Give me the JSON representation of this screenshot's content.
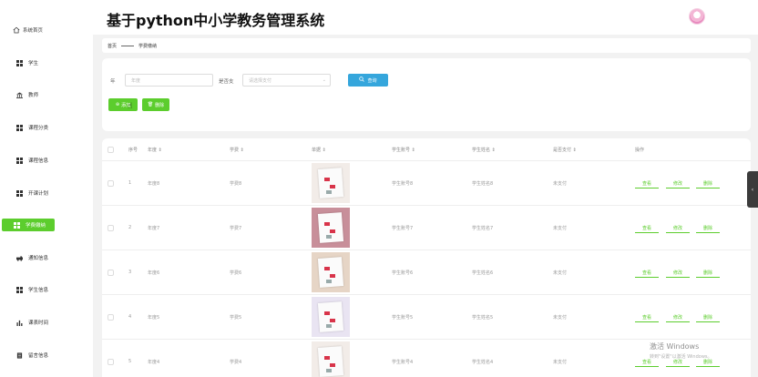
{
  "app": {
    "title": "基于python中小学教务管理系统"
  },
  "sidebar": {
    "home": "系统首页",
    "items": [
      {
        "label": "学生",
        "icon": "grid-icon"
      },
      {
        "label": "教师",
        "icon": "bank-icon"
      },
      {
        "label": "课程分类",
        "icon": "grid-icon"
      },
      {
        "label": "课程信息",
        "icon": "grid-icon"
      },
      {
        "label": "开课计划",
        "icon": "grid-icon"
      },
      {
        "label": "学费缴纳",
        "icon": "grid-icon",
        "active": true
      },
      {
        "label": "通知信息",
        "icon": "car-icon"
      },
      {
        "label": "学生信息",
        "icon": "grid-icon"
      },
      {
        "label": "课表时间",
        "icon": "bar-chart-icon"
      },
      {
        "label": "留言信息",
        "icon": "doc-icon"
      }
    ]
  },
  "breadcrumb": {
    "home": "首页",
    "current": "学费缴纳"
  },
  "search": {
    "year_label": "年",
    "year_placeholder": "年度",
    "paid_label": "是否支",
    "paid_placeholder": "请选择支付",
    "search_button": "查询",
    "add_button": "添加",
    "delete_button": "删除"
  },
  "table": {
    "headers": [
      "序号",
      "年度 ⇕",
      "学费 ⇕",
      "单据 ⇕",
      "学生账号 ⇕",
      "学生姓名 ⇕",
      "是否支付 ⇕",
      "操作"
    ],
    "rows": [
      {
        "index": "1",
        "year": "年度8",
        "fee": "学费8",
        "account": "学生账号8",
        "name": "学生姓名8",
        "paid": "未支付"
      },
      {
        "index": "2",
        "year": "年度7",
        "fee": "学费7",
        "account": "学生账号7",
        "name": "学生姓名7",
        "paid": "未支付"
      },
      {
        "index": "3",
        "year": "年度6",
        "fee": "学费6",
        "account": "学生账号6",
        "name": "学生姓名6",
        "paid": "未支付"
      },
      {
        "index": "4",
        "year": "年度5",
        "fee": "学费5",
        "account": "学生账号5",
        "name": "学生姓名5",
        "paid": "未支付"
      },
      {
        "index": "5",
        "year": "年度4",
        "fee": "学费4",
        "account": "学生账号4",
        "name": "学生姓名4",
        "paid": "未支付"
      }
    ],
    "actions": {
      "view": "查看",
      "edit": "修改",
      "delete": "删除"
    }
  },
  "watermark": {
    "line1": "激活 Windows",
    "line2": "转到\"设置\"以激活 Windows。"
  },
  "colors": {
    "accent": "#5ccd2d",
    "search_button": "#35a6dc"
  }
}
